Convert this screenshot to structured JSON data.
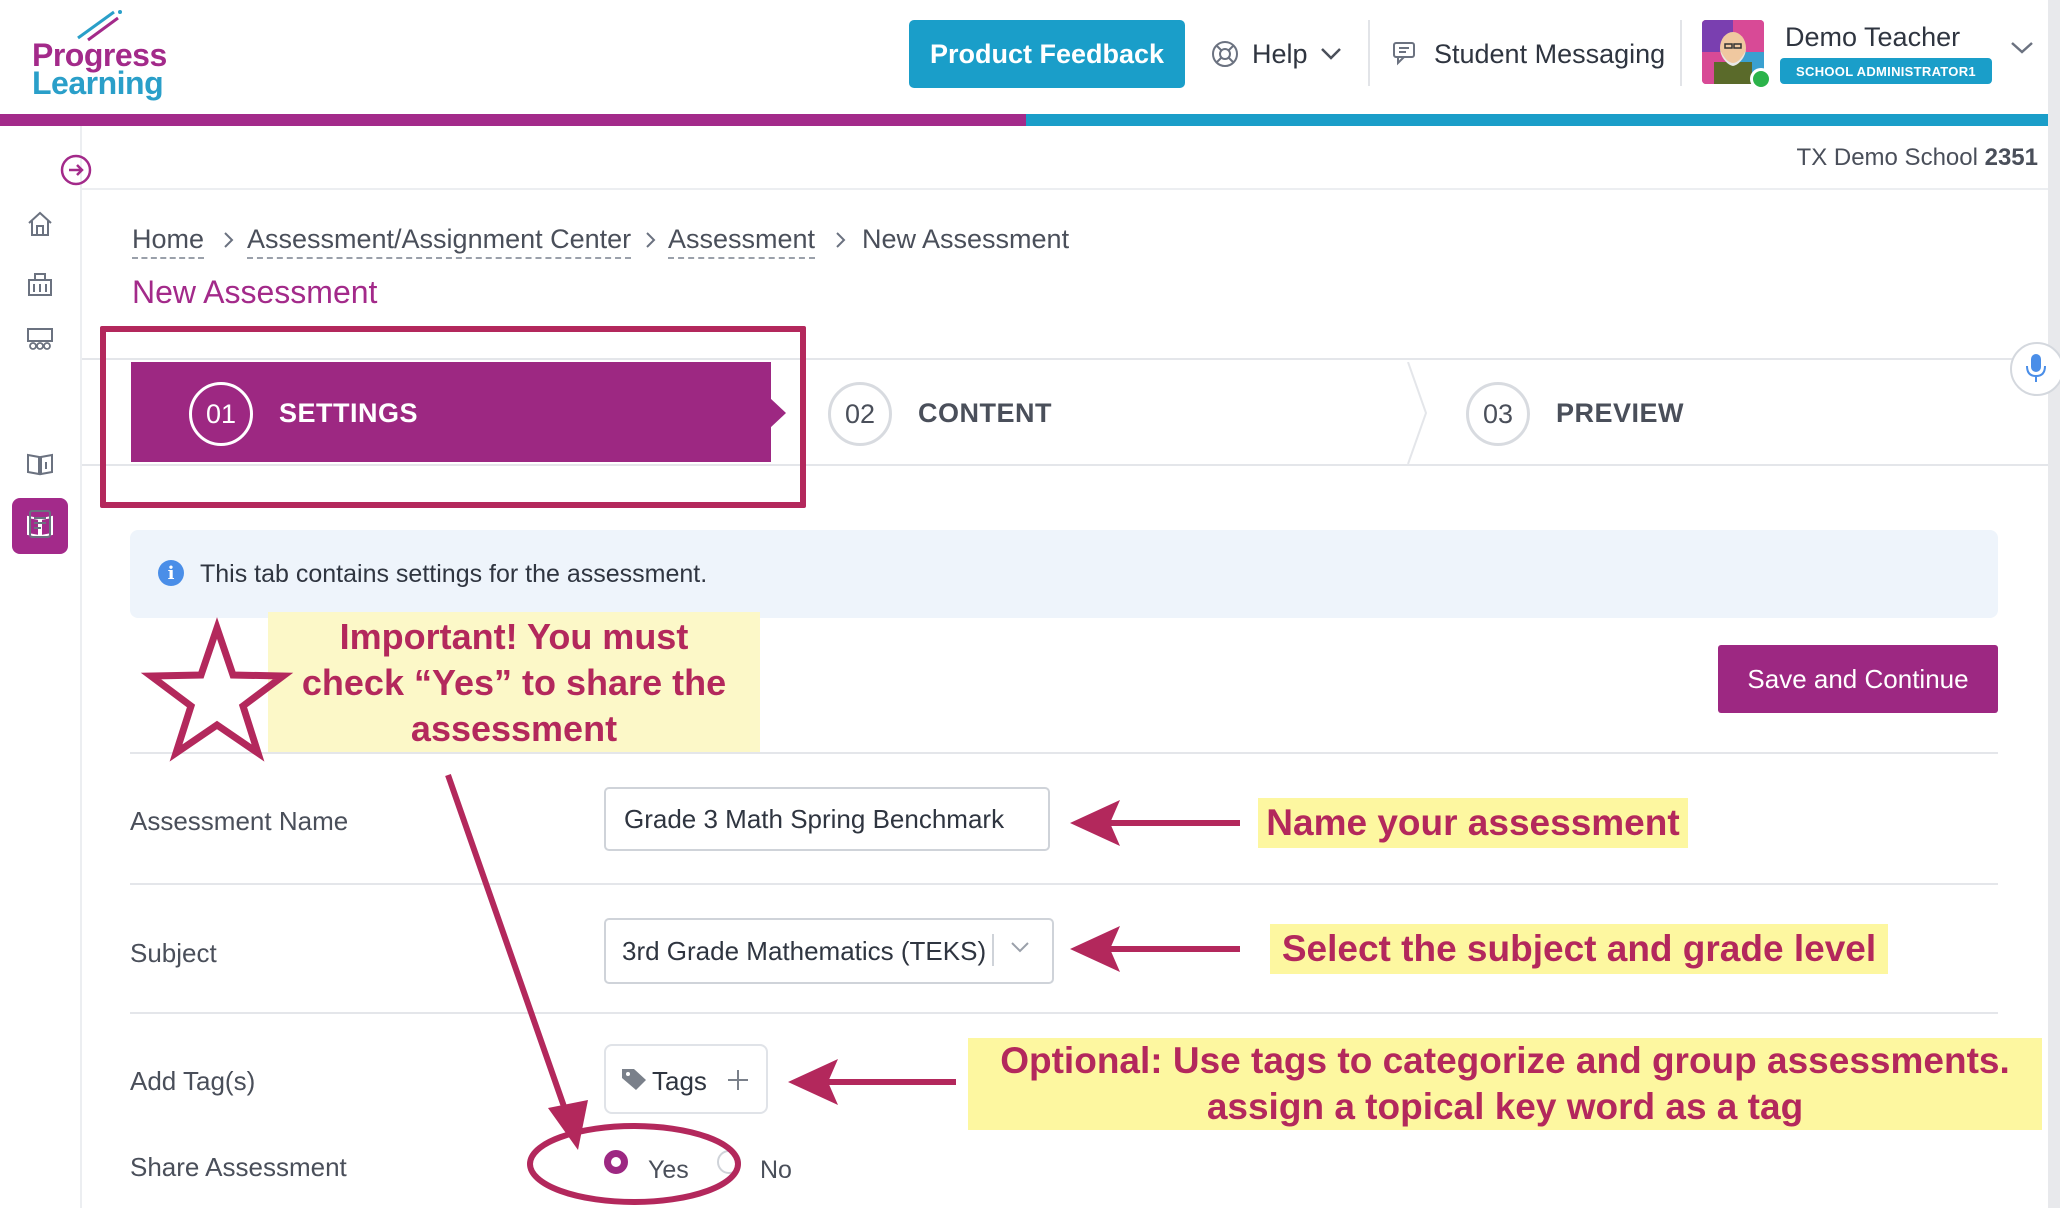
{
  "header": {
    "logo_line1": "Progress",
    "logo_line2": "Learning",
    "feedback_button": "Product Feedback",
    "help_label": "Help",
    "messaging_label": "Student Messaging",
    "user_name": "Demo Teacher",
    "user_role": "SCHOOL ADMINISTRATOR1"
  },
  "school": {
    "name": "TX Demo School",
    "id": "2351"
  },
  "breadcrumb": [
    "Home",
    "Assessment/Assignment Center",
    "Assessment",
    "New Assessment"
  ],
  "page_title": "New Assessment",
  "steps": [
    {
      "number": "01",
      "label": "SETTINGS",
      "active": true
    },
    {
      "number": "02",
      "label": "CONTENT",
      "active": false
    },
    {
      "number": "03",
      "label": "PREVIEW",
      "active": false
    }
  ],
  "info_text": "This tab contains settings for the assessment.",
  "save_button": "Save and Continue",
  "form": {
    "name_label": "Assessment Name",
    "name_value": "Grade 3 Math Spring Benchmark",
    "subject_label": "Subject",
    "subject_value": "3rd Grade Mathematics (TEKS)",
    "tags_label": "Add Tag(s)",
    "tags_button": "Tags",
    "share_label": "Share Assessment",
    "share_yes": "Yes",
    "share_no": "No",
    "share_selected": "Yes"
  },
  "annotations": {
    "important_line1": "Important!  You must",
    "important_line2": "check “Yes” to share the",
    "important_line3": "assessment",
    "name_note": "Name your assessment",
    "subject_note": "Select the subject and grade level",
    "optional_line1": "Optional:  Use tags to categorize and group assessments.",
    "optional_line2": "assign a topical key word as a tag"
  },
  "colors": {
    "brand_purple": "#9d2882",
    "brand_blue": "#1a9ec9",
    "annotation_red": "#b3285c",
    "annotation_yellow": "#fdf7a0"
  }
}
